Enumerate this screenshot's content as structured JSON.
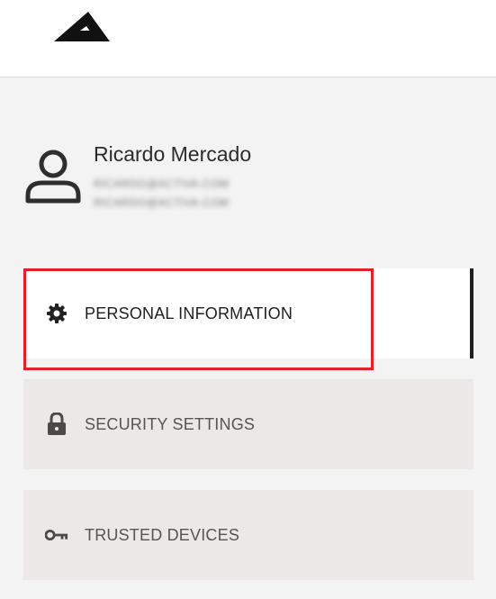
{
  "user": {
    "name": "Ricardo Mercado",
    "email_primary": "RICARDO@ACTIVA.COM",
    "email_secondary": "RICARDO@ACTIVA.COM"
  },
  "nav": {
    "items": [
      {
        "label": "PERSONAL INFORMATION",
        "icon": "gear-icon",
        "active": true
      },
      {
        "label": "SECURITY SETTINGS",
        "icon": "lock-icon",
        "active": false
      },
      {
        "label": "TRUSTED DEVICES",
        "icon": "key-icon",
        "active": false
      }
    ]
  },
  "colors": {
    "highlight": "#e0202a",
    "inactive_bg": "#ece8e7",
    "active_bg": "#ffffff",
    "active_indicator": "#1f1f1f"
  }
}
